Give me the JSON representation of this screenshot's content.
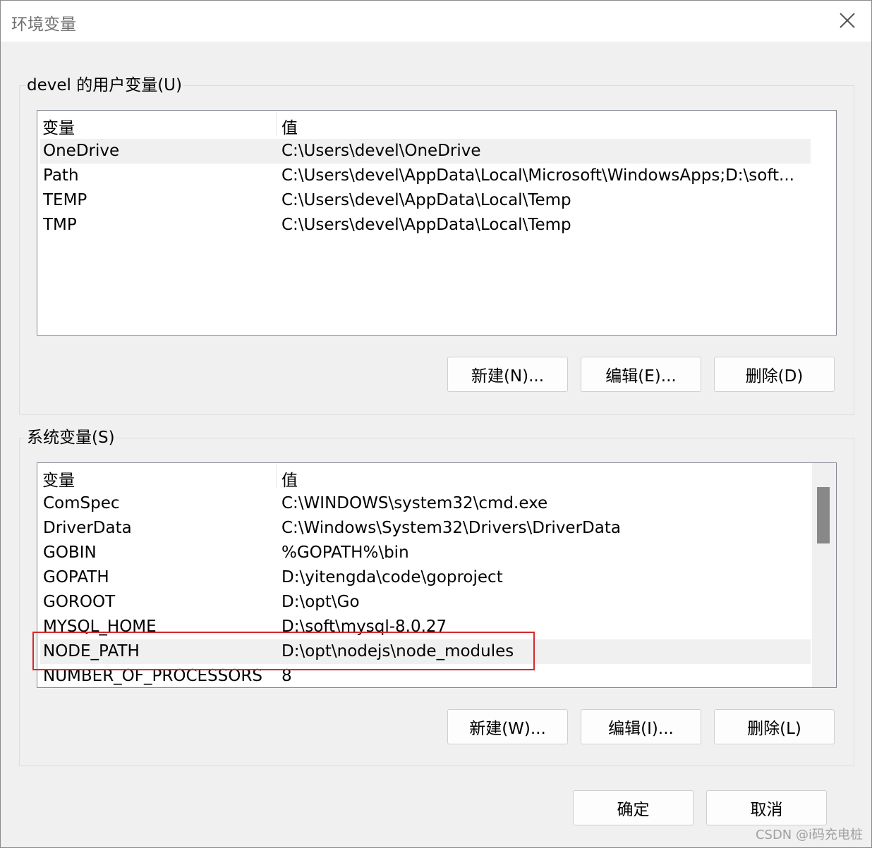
{
  "window": {
    "title": "环境变量",
    "close_icon": "close-icon"
  },
  "user_vars": {
    "group_label": "devel 的用户变量(U)",
    "columns": [
      "变量",
      "值"
    ],
    "rows": [
      {
        "name": "OneDrive",
        "value": "C:\\Users\\devel\\OneDrive"
      },
      {
        "name": "Path",
        "value": "C:\\Users\\devel\\AppData\\Local\\Microsoft\\WindowsApps;D:\\soft..."
      },
      {
        "name": "TEMP",
        "value": "C:\\Users\\devel\\AppData\\Local\\Temp"
      },
      {
        "name": "TMP",
        "value": "C:\\Users\\devel\\AppData\\Local\\Temp"
      }
    ],
    "buttons": {
      "new": "新建(N)...",
      "edit": "编辑(E)...",
      "delete": "删除(D)"
    }
  },
  "system_vars": {
    "group_label": "系统变量(S)",
    "columns": [
      "变量",
      "值"
    ],
    "rows": [
      {
        "name": "ComSpec",
        "value": "C:\\WINDOWS\\system32\\cmd.exe"
      },
      {
        "name": "DriverData",
        "value": "C:\\Windows\\System32\\Drivers\\DriverData"
      },
      {
        "name": "GOBIN",
        "value": "%GOPATH%\\bin"
      },
      {
        "name": "GOPATH",
        "value": "D:\\yitengda\\code\\goproject"
      },
      {
        "name": "GOROOT",
        "value": "D:\\opt\\Go"
      },
      {
        "name": "MYSQL_HOME",
        "value": "D:\\soft\\mysql-8.0.27"
      },
      {
        "name": "NODE_PATH",
        "value": "D:\\opt\\nodejs\\node_modules"
      },
      {
        "name": "NUMBER_OF_PROCESSORS",
        "value": "8"
      }
    ],
    "buttons": {
      "new": "新建(W)...",
      "edit": "编辑(I)...",
      "delete": "删除(L)"
    }
  },
  "footer": {
    "ok": "确定",
    "cancel": "取消"
  },
  "watermark": "CSDN @i码充电桩",
  "colors": {
    "highlight": "#d9292b",
    "selected_row": "#f0f0f0"
  }
}
